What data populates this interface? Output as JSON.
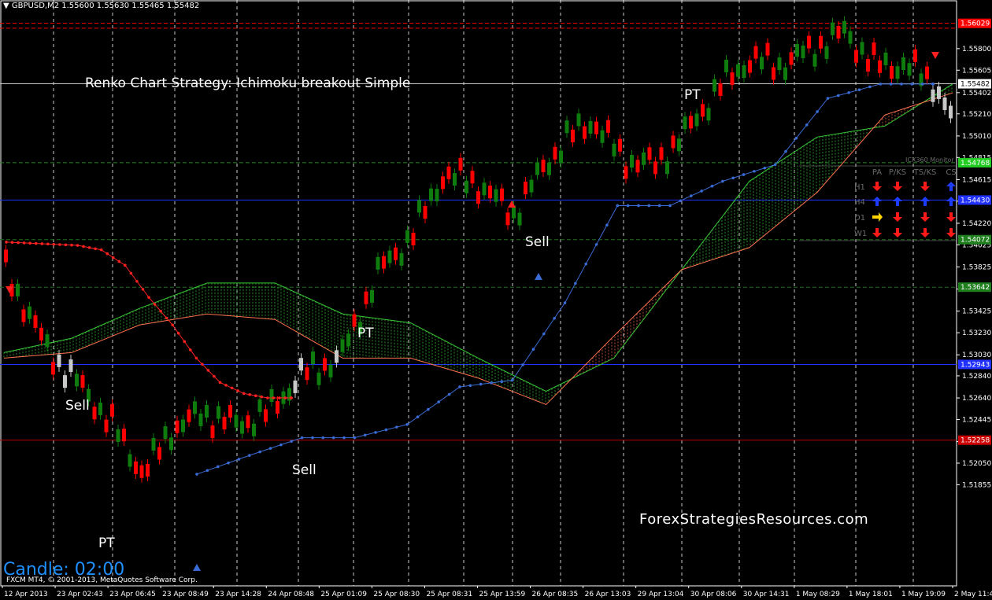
{
  "header": {
    "symbol_info": "GBPUSD,M2  1.55600 1.55630 1.55465 1.55482"
  },
  "title": "Renko Chart Strategy: Ichimoku breakout Simple",
  "watermark": "ForexStrategiesResources.com",
  "candle_timer": "Candle:  02:00",
  "copyright": "FXCM MT4, © 2001-2013, MetaQuotes Software Corp.",
  "annotations": [
    {
      "text": "Sell"
    },
    {
      "text": "PT"
    },
    {
      "text": "Sell"
    },
    {
      "text": "PT"
    },
    {
      "text": "Sell"
    },
    {
      "text": "PT"
    }
  ],
  "signal_table": {
    "headers": [
      "PA",
      "P/KS",
      "TS/KS",
      "CS"
    ],
    "rows": [
      "H1",
      "H4",
      "D1",
      "W1"
    ],
    "arrows": [
      [
        "down",
        "down",
        "down",
        "up"
      ],
      [
        "up",
        "up",
        "up",
        "up"
      ],
      [
        "up-yellow",
        "down",
        "down",
        "down"
      ],
      [
        "down",
        "down",
        "down",
        "down"
      ]
    ],
    "caption": "ICX360 Monitor"
  },
  "colors": {
    "bull": "#0e7d0e",
    "bear": "#ff0000",
    "neutral": "#c8c8c8",
    "tenkan": "#ff2020",
    "kijun": "#3a6bd4",
    "spanA": "#37c837",
    "spanB": "#ff7050",
    "blue_line": "#2030ff",
    "grid": "#ffffff"
  },
  "chart_data": {
    "type": "line",
    "price_axis": {
      "min": 1.5094,
      "max": 1.5624,
      "ticks": [
        "1.56195",
        "1.55800",
        "1.55605",
        "1.55402",
        "1.55210",
        "1.55010",
        "1.54815",
        "1.54615",
        "1.54420",
        "1.54220",
        "1.54025",
        "1.53825",
        "1.53625",
        "1.53425",
        "1.53230",
        "1.53030",
        "1.52840",
        "1.52640",
        "1.52445",
        "1.52245",
        "1.52050",
        "1.51855"
      ]
    },
    "time_labels": [
      "12 Apr 2013",
      "23 Apr 02:43",
      "23 Apr 06:45",
      "23 Apr 08:49",
      "23 Apr 14:28",
      "24 Apr 08:48",
      "25 Apr 01:09",
      "25 Apr 08:30",
      "25 Apr 08:31",
      "25 Apr 13:59",
      "26 Apr 08:35",
      "26 Apr 13:03",
      "29 Apr 13:04",
      "30 Apr 08:06",
      "30 Apr 14:31",
      "1 May 08:29",
      "1 May 18:01",
      "1 May 19:09",
      "2 May 11:46"
    ],
    "price_labels": [
      {
        "value": 1.56029,
        "text": "1.56029",
        "color": "#ff0000"
      },
      {
        "value": 1.55482,
        "text": "1.55482",
        "color": "#ffffff"
      },
      {
        "value": 1.54768,
        "text": "1.54768",
        "color": "#22cc22"
      },
      {
        "value": 1.5443,
        "text": "1.54430",
        "color": "#2030ff"
      },
      {
        "value": 1.54072,
        "text": "1.54072",
        "color": "#1f7f1f"
      },
      {
        "value": 1.53642,
        "text": "1.53642",
        "color": "#1f7f1f"
      },
      {
        "value": 1.52943,
        "text": "1.52943",
        "color": "#2030ff"
      },
      {
        "value": 1.52258,
        "text": "1.52258",
        "color": "#cc0000"
      }
    ],
    "horizontal_lines": [
      {
        "value": 1.56029,
        "color": "#ff0000",
        "style": "dashed"
      },
      {
        "value": 1.55985,
        "color": "#ff0000",
        "style": "dashed"
      },
      {
        "value": 1.55482,
        "color": "#c8c8c8",
        "style": "solid"
      },
      {
        "value": 1.54768,
        "color": "#2a8a2a",
        "style": "dashed"
      },
      {
        "value": 1.5443,
        "color": "#2030ff",
        "style": "solid"
      },
      {
        "value": 1.54072,
        "color": "#1f6f1f",
        "style": "dashed"
      },
      {
        "value": 1.53642,
        "color": "#1f6f1f",
        "style": "dashed"
      },
      {
        "value": 1.52943,
        "color": "#2030ff",
        "style": "solid"
      },
      {
        "value": 1.52258,
        "color": "#c00000",
        "style": "solid"
      }
    ],
    "series": [
      {
        "name": "Tenkan",
        "values": [
          1.5405,
          1.5404,
          1.5403,
          1.5402,
          1.5398,
          1.5384,
          1.5355,
          1.533,
          1.53,
          1.5278,
          1.5268,
          1.5264,
          1.5264
        ]
      },
      {
        "name": "Kijun",
        "values": [
          1.5195,
          1.5212,
          1.5228,
          1.5228,
          1.524,
          1.5274,
          1.528,
          1.535,
          1.5438,
          1.5438,
          1.546,
          1.5475,
          1.5535,
          1.5548,
          1.5548
        ]
      },
      {
        "name": "Span A",
        "values": [
          1.5305,
          1.5318,
          1.5345,
          1.5368,
          1.5368,
          1.534,
          1.5332,
          1.53,
          1.527,
          1.53,
          1.538,
          1.546,
          1.55,
          1.551,
          1.5548
        ]
      },
      {
        "name": "Span B",
        "values": [
          1.53,
          1.5305,
          1.533,
          1.534,
          1.5335,
          1.53,
          1.53,
          1.5282,
          1.5258,
          1.532,
          1.538,
          1.54,
          1.545,
          1.552,
          1.554
        ]
      }
    ]
  }
}
